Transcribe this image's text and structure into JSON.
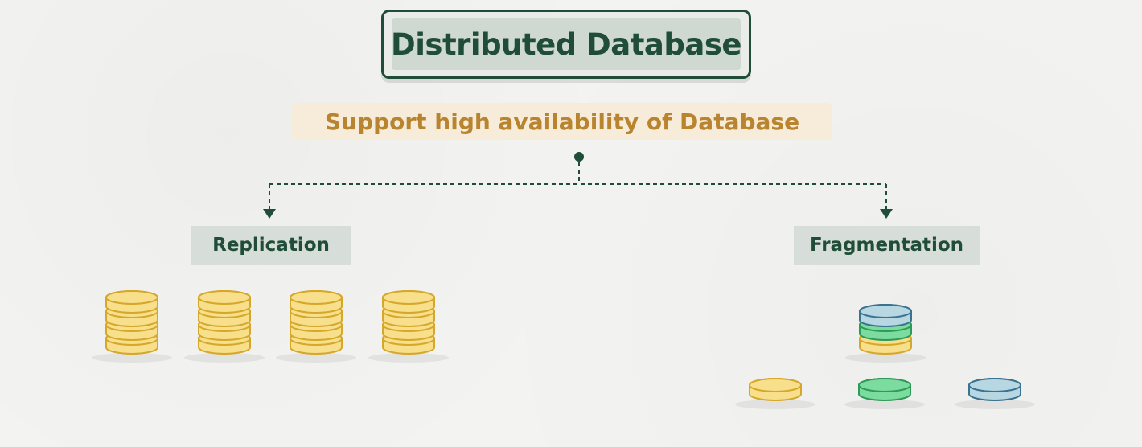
{
  "title": "Distributed Database",
  "subtitle": "Support high availability of Database",
  "branches": {
    "left": "Replication",
    "right": "Fragmentation"
  },
  "colors": {
    "dark_green": "#1f4d38",
    "gold_text": "#b9842f",
    "yellow_fill": "#f8df8c",
    "yellow_stroke": "#d5a72a",
    "green_fill": "#7cdca0",
    "green_stroke": "#2e9a57",
    "blue_fill": "#b7d7e3",
    "blue_stroke": "#3b7290"
  },
  "replication_stacks": [
    [
      "yellow",
      "yellow",
      "yellow",
      "yellow"
    ],
    [
      "yellow",
      "yellow",
      "yellow",
      "yellow"
    ],
    [
      "yellow",
      "yellow",
      "yellow",
      "yellow"
    ],
    [
      "yellow",
      "yellow",
      "yellow",
      "yellow"
    ]
  ],
  "fragmentation_stack": [
    "yellow",
    "green",
    "blue"
  ],
  "fragments": [
    "yellow",
    "green",
    "blue"
  ]
}
